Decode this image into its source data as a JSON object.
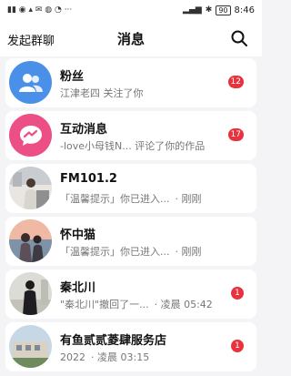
{
  "status_bar": {
    "time": "8:46",
    "battery": "90"
  },
  "header": {
    "left_action": "发起群聊",
    "title": "消息"
  },
  "messages": [
    {
      "name": "粉丝",
      "preview": "江津老四 关注了你",
      "time": "",
      "badge": "12"
    },
    {
      "name": "互动消息",
      "preview": "-love小母钱N... 评论了你的作品",
      "time": "",
      "badge": "17"
    },
    {
      "name": "FM101.2",
      "preview": "「温馨提示」你已进入...",
      "time": "· 刚刚",
      "badge": ""
    },
    {
      "name": "怀中猫",
      "preview": "「温馨提示」你已进入...",
      "time": "· 刚刚",
      "badge": ""
    },
    {
      "name": "秦北川",
      "preview": "\"秦北川\"撤回了一...",
      "time": "· 凌晨 05:42",
      "badge": "1"
    },
    {
      "name": "有鱼贰贰菱肆服务店",
      "preview": "2022",
      "time": "· 凌晨 03:15",
      "badge": "1"
    }
  ]
}
